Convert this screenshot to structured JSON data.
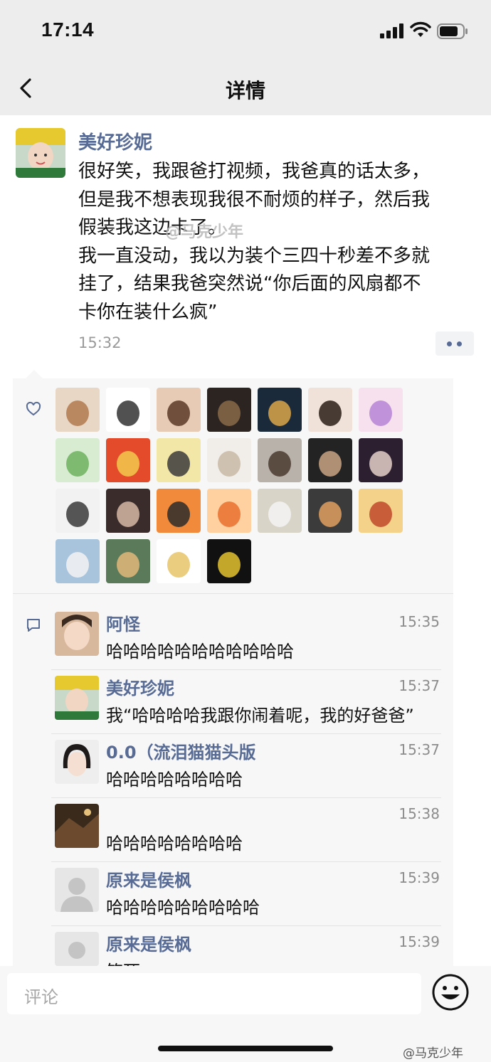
{
  "status_bar": {
    "time": "17:14"
  },
  "nav": {
    "title": "详情"
  },
  "post": {
    "author": "美好珍妮",
    "body_lines": [
      "很好笑，我跟爸打视频，我爸真的话太多，",
      "但是我不想表现我很不耐烦的样子，然后我",
      "假装我这边卡了。",
      "我一直没动，我以为装个三四十秒差不多就",
      "挂了，结果我爸突然说“你后面的风扇都不",
      "卡你在装什么疯”"
    ],
    "time": "15:32",
    "watermark": "@马克少年"
  },
  "likes": {
    "count_shown": 25
  },
  "comments": [
    {
      "name": "阿怪",
      "time": "15:35",
      "text": "哈哈哈哈哈哈哈哈哈哈哈"
    },
    {
      "name": "美好珍妮",
      "time": "15:37",
      "text": "我“哈哈哈哈我跟你闹着呢，我的好爸爸”"
    },
    {
      "name": "0.0（流泪猫猫头版",
      "time": "15:37",
      "text": "哈哈哈哈哈哈哈哈"
    },
    {
      "name": "",
      "time": "15:38",
      "text": "哈哈哈哈哈哈哈哈"
    },
    {
      "name": "原来是侯枫",
      "time": "15:39",
      "text": "哈哈哈哈哈哈哈哈哈"
    },
    {
      "name": "原来是侯枫",
      "time": "15:39",
      "text": "笑死"
    }
  ],
  "input": {
    "placeholder": "评论"
  },
  "footer": {
    "watermark": "@马克少年"
  },
  "colors": {
    "link": "#576b95",
    "nav_bg": "#ededed",
    "panel_bg": "#f7f7f7"
  },
  "icons": [
    "back-icon",
    "heart-icon",
    "comment-icon",
    "emoji-icon",
    "signal-icon",
    "wifi-icon",
    "battery-icon",
    "more-icon"
  ]
}
